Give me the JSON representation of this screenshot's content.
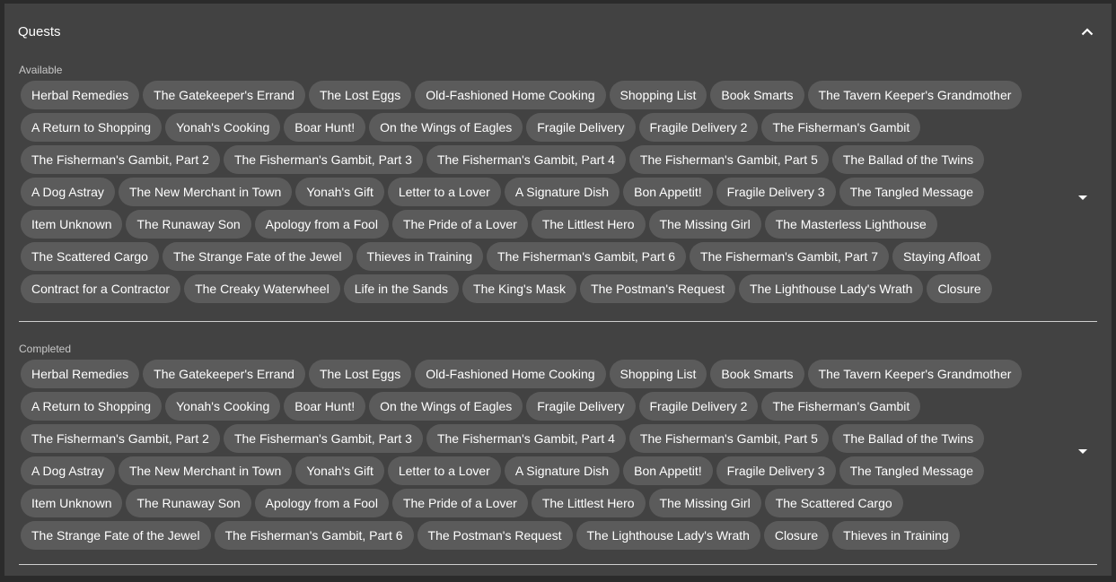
{
  "panel": {
    "title": "Quests",
    "collapse_icon": "chevron-up-icon"
  },
  "available": {
    "label": "Available",
    "dropdown_icon": "caret-down-icon",
    "quests": [
      "Herbal Remedies",
      "The Gatekeeper's Errand",
      "The Lost Eggs",
      "Old-Fashioned Home Cooking",
      "Shopping List",
      "Book Smarts",
      "The Tavern Keeper's Grandmother",
      "A Return to Shopping",
      "Yonah's Cooking",
      "Boar Hunt!",
      "On the Wings of Eagles",
      "Fragile Delivery",
      "Fragile Delivery 2",
      "The Fisherman's Gambit",
      "The Fisherman's Gambit, Part 2",
      "The Fisherman's Gambit, Part 3",
      "The Fisherman's Gambit, Part 4",
      "The Fisherman's Gambit, Part 5",
      "The Ballad of the Twins",
      "A Dog Astray",
      "The New Merchant in Town",
      "Yonah's Gift",
      "Letter to a Lover",
      "A Signature Dish",
      "Bon Appetit!",
      "Fragile Delivery 3",
      "The Tangled Message",
      "Item Unknown",
      "The Runaway Son",
      "Apology from a Fool",
      "The Pride of a Lover",
      "The Littlest Hero",
      "The Missing Girl",
      "The Masterless Lighthouse",
      "The Scattered Cargo",
      "The Strange Fate of the Jewel",
      "Thieves in Training",
      "The Fisherman's Gambit, Part 6",
      "The Fisherman's Gambit, Part 7",
      "Staying Afloat",
      "Contract for a Contractor",
      "The Creaky Waterwheel",
      "Life in the Sands",
      "The King's Mask",
      "The Postman's Request",
      "The Lighthouse Lady's Wrath",
      "Closure"
    ]
  },
  "completed": {
    "label": "Completed",
    "dropdown_icon": "caret-down-icon",
    "quests": [
      "Herbal Remedies",
      "The Gatekeeper's Errand",
      "The Lost Eggs",
      "Old-Fashioned Home Cooking",
      "Shopping List",
      "Book Smarts",
      "The Tavern Keeper's Grandmother",
      "A Return to Shopping",
      "Yonah's Cooking",
      "Boar Hunt!",
      "On the Wings of Eagles",
      "Fragile Delivery",
      "Fragile Delivery 2",
      "The Fisherman's Gambit",
      "The Fisherman's Gambit, Part 2",
      "The Fisherman's Gambit, Part 3",
      "The Fisherman's Gambit, Part 4",
      "The Fisherman's Gambit, Part 5",
      "The Ballad of the Twins",
      "A Dog Astray",
      "The New Merchant in Town",
      "Yonah's Gift",
      "Letter to a Lover",
      "A Signature Dish",
      "Bon Appetit!",
      "Fragile Delivery 3",
      "The Tangled Message",
      "Item Unknown",
      "The Runaway Son",
      "Apology from a Fool",
      "The Pride of a Lover",
      "The Littlest Hero",
      "The Missing Girl",
      "The Scattered Cargo",
      "The Strange Fate of the Jewel",
      "The Fisherman's Gambit, Part 6",
      "The Postman's Request",
      "The Lighthouse Lady's Wrath",
      "Closure",
      "Thieves in Training"
    ]
  },
  "colors": {
    "panel_bg": "#424242",
    "chip_bg": "#5b5b5b",
    "text": "#ffffff"
  }
}
